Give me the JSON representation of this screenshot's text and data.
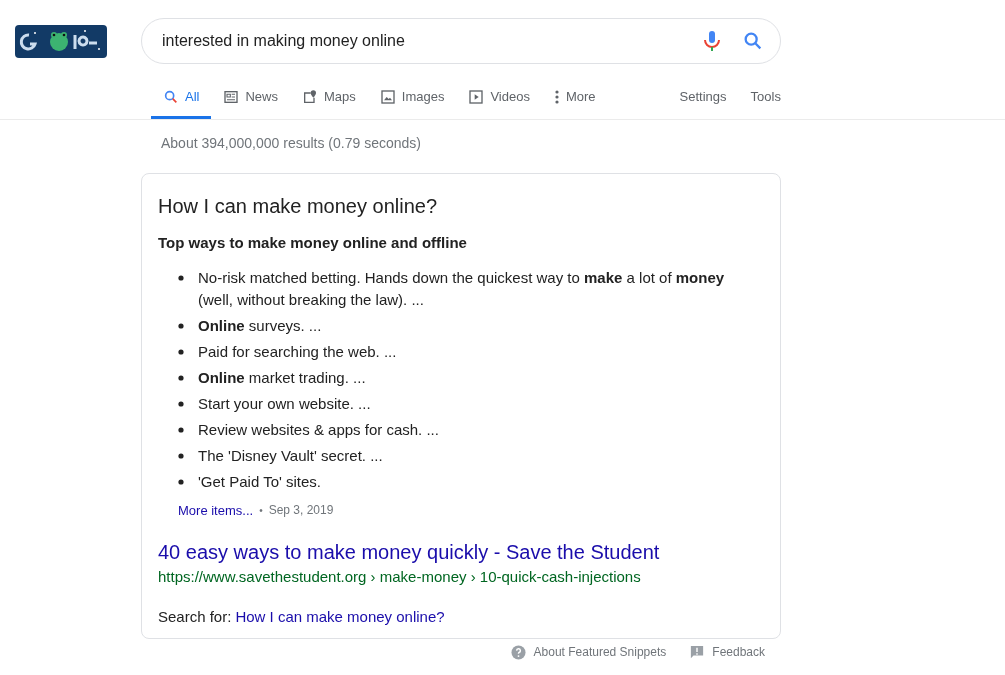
{
  "search": {
    "value": "interested in making money online"
  },
  "tabs": [
    {
      "label": "All",
      "selected": true
    },
    {
      "label": "News",
      "selected": false
    },
    {
      "label": "Maps",
      "selected": false
    },
    {
      "label": "Images",
      "selected": false
    },
    {
      "label": "Videos",
      "selected": false
    },
    {
      "label": "More",
      "selected": false
    }
  ],
  "tools": [
    "Settings",
    "Tools"
  ],
  "result_stats": "About 394,000,000 results (0.79 seconds)",
  "snippet": {
    "question": "How I can make money online?",
    "heading": "Top ways to make money online and offline",
    "items": [
      "No-risk matched betting. Hands down the quickest way to **make** a lot of **money** (well, without breaking the law). ...",
      "**Online** surveys. ...",
      "Paid for searching the web. ...",
      "**Online** market trading. ...",
      "Start your own website. ...",
      "Review websites & apps for cash. ...",
      "The 'Disney Vault' secret. ...",
      "'Get Paid To' sites."
    ],
    "more_link": "More items...",
    "separator": "•",
    "date": "Sep 3, 2019",
    "result_title": "40 easy ways to make money quickly - Save the Student",
    "result_url": "https://www.savethestudent.org › make-money › 10-quick-cash-injections",
    "search_for_label": "Search for:",
    "search_for_link": "How I can make money online?"
  },
  "footer": [
    "About Featured Snippets",
    "Feedback"
  ]
}
